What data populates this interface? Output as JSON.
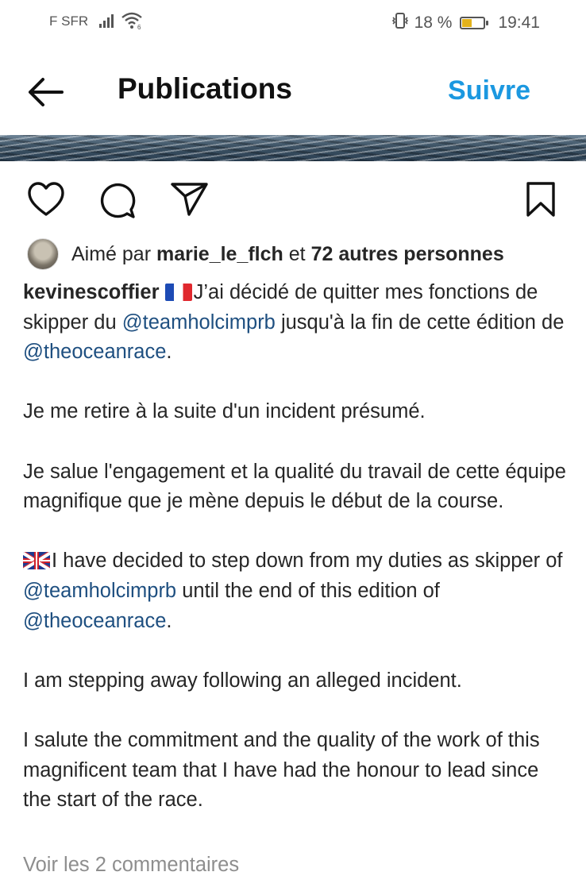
{
  "status_bar": {
    "carrier": "F SFR",
    "battery_percent": "18 %",
    "battery_level": 0.18,
    "time": "19:41",
    "icons": [
      "signal-icon",
      "wifi-icon",
      "vibrate-icon",
      "battery-icon"
    ]
  },
  "header": {
    "title": "Publications",
    "follow_label": "Suivre",
    "back_icon": "arrow-left-icon",
    "accent_color": "#1b98e0"
  },
  "actions": {
    "icons": [
      "heart-icon",
      "comment-icon",
      "share-icon",
      "bookmark-icon"
    ]
  },
  "likes": {
    "prefix": "Aimé par ",
    "user": "marie_le_flch",
    "conjunction": " et ",
    "others": "72 autres personnes"
  },
  "post": {
    "author": "kevinescoffier",
    "fr_p1_a": "J’ai décidé de quitter mes fonctions de skipper du ",
    "mention_team": "@teamholcimprb",
    "fr_p1_b": " jusqu'à la fin de cette édition de ",
    "mention_race": "@theoceanrace",
    "fr_p1_c": ".",
    "fr_p2": "Je me retire à la suite d'un incident présumé.",
    "fr_p3": "Je salue l'engagement et la qualité du travail de cette équipe magnifique que je mène depuis le début de la course.",
    "en_p1_a": "I have decided to step down from my duties as skipper of ",
    "en_p1_b": " until the end of this edition of ",
    "en_p1_c": ".",
    "en_p2": "I am stepping away following an alleged incident.",
    "en_p3": "I salute the commitment and the quality of the work of this magnificent team that I have had the honour to lead since the start of the race.",
    "mention_color": "#1e4f80"
  },
  "comments": {
    "view_label": "Voir les 2 commentaires"
  }
}
